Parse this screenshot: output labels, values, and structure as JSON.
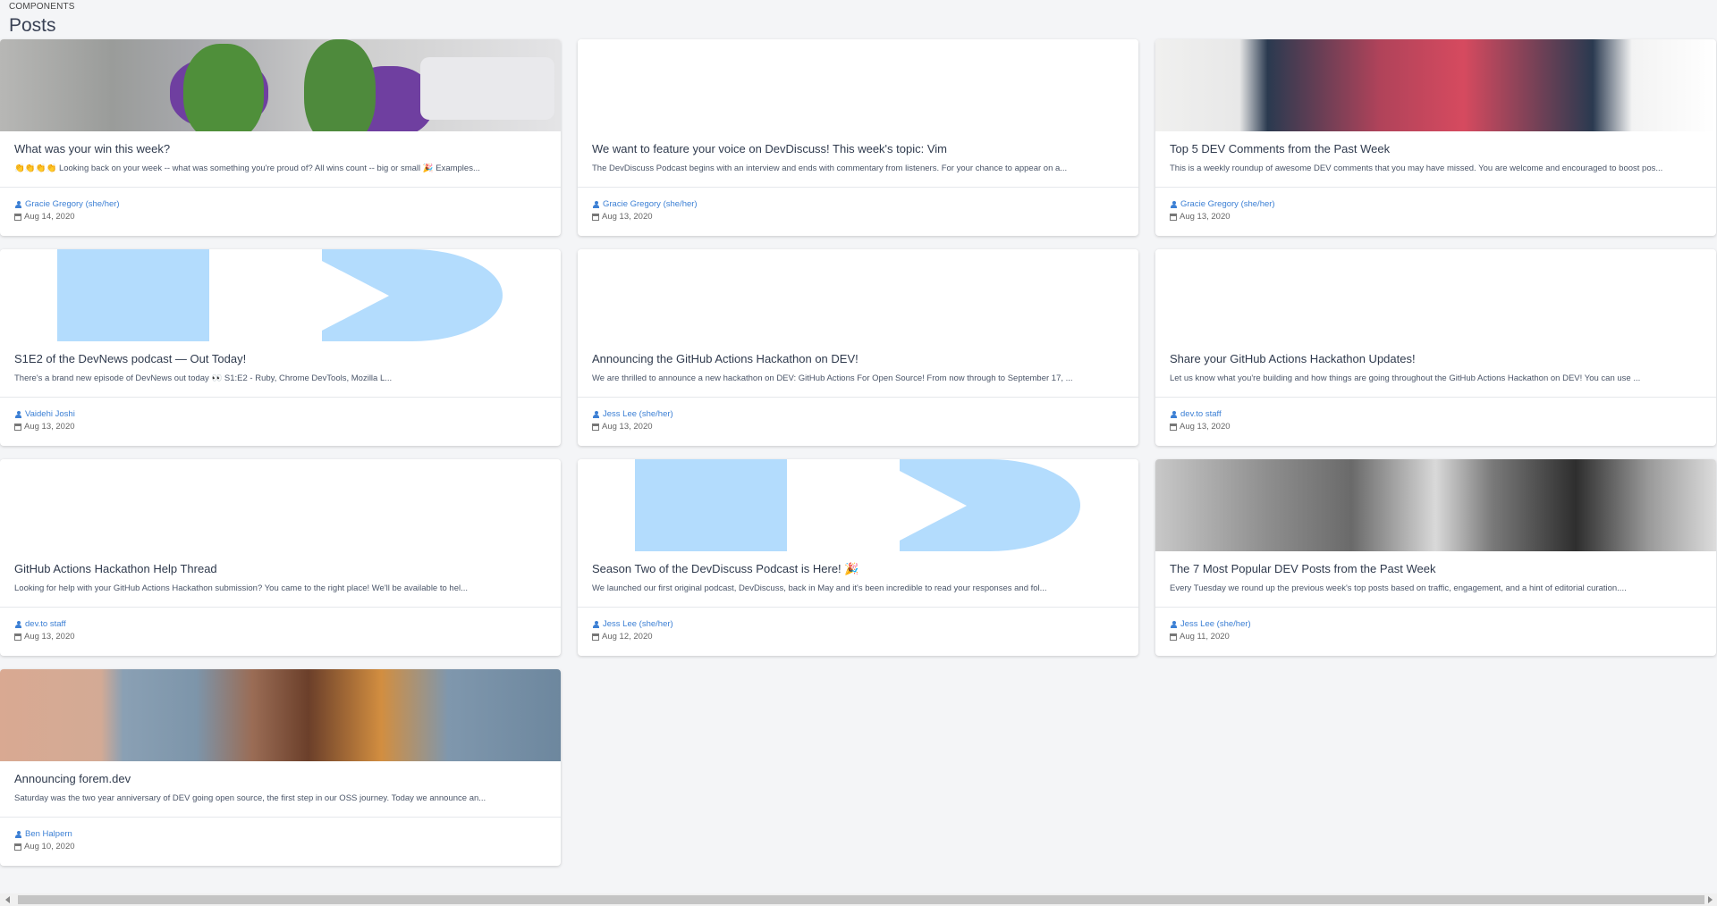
{
  "header": {
    "eyebrow": "COMPONENTS",
    "title": "Posts"
  },
  "posts": [
    {
      "title": "What was your win this week?",
      "excerpt": "👏👏👏👏 Looking back on your week -- what was something you're proud of? All wins count -- big or small 🎉 Examples...",
      "author": "Gracie Gregory (she/her)",
      "date": "Aug 14, 2020"
    },
    {
      "title": "We want to feature your voice on DevDiscuss! This week's topic: Vim",
      "excerpt": "The DevDiscuss Podcast begins with an interview and ends with commentary from listeners. For your chance to appear on a...",
      "author": "Gracie Gregory (she/her)",
      "date": "Aug 13, 2020"
    },
    {
      "title": "Top 5 DEV Comments from the Past Week",
      "excerpt": "This is a weekly roundup of awesome DEV comments that you may have missed. You are welcome and encouraged to boost pos...",
      "author": "Gracie Gregory (she/her)",
      "date": "Aug 13, 2020"
    },
    {
      "title": "S1E2 of the DevNews podcast — Out Today!",
      "excerpt": "There's a brand new episode of DevNews out today 👀 S1:E2 - Ruby, Chrome DevTools, Mozilla L...",
      "author": "Vaidehi Joshi",
      "date": "Aug 13, 2020"
    },
    {
      "title": "Announcing the GitHub Actions Hackathon on DEV!",
      "excerpt": "We are thrilled to announce a new hackathon on DEV: GitHub Actions For Open Source! From now through to September 17, ...",
      "author": "Jess Lee (she/her)",
      "date": "Aug 13, 2020"
    },
    {
      "title": "Share your GitHub Actions Hackathon Updates!",
      "excerpt": "Let us know what you're building and how things are going throughout the GitHub Actions Hackathon on DEV! You can use ...",
      "author": "dev.to staff",
      "date": "Aug 13, 2020"
    },
    {
      "title": "GitHub Actions Hackathon Help Thread",
      "excerpt": "Looking for help with your GitHub Actions Hackathon submission? You came to the right place! We'll be available to hel...",
      "author": "dev.to staff",
      "date": "Aug 13, 2020"
    },
    {
      "title": "Season Two of the DevDiscuss Podcast is Here! 🎉",
      "excerpt": "We launched our first original podcast, DevDiscuss, back in May and it's been incredible to read your responses and fol...",
      "author": "Jess Lee (she/her)",
      "date": "Aug 12, 2020"
    },
    {
      "title": "The 7 Most Popular DEV Posts from the Past Week",
      "excerpt": "Every Tuesday we round up the previous week's top posts based on traffic, engagement, and a hint of editorial curation....",
      "author": "Jess Lee (she/her)",
      "date": "Aug 11, 2020"
    },
    {
      "title": "Announcing forem.dev",
      "excerpt": "Saturday was the two year anniversary of DEV going open source, the first step in our OSS journey. Today we announce an...",
      "author": "Ben Halpern",
      "date": "Aug 10, 2020"
    }
  ],
  "colors": {
    "author_link": "#3b7fd4",
    "background": "#f4f5f7",
    "play_blue": "#b3dcfd"
  }
}
